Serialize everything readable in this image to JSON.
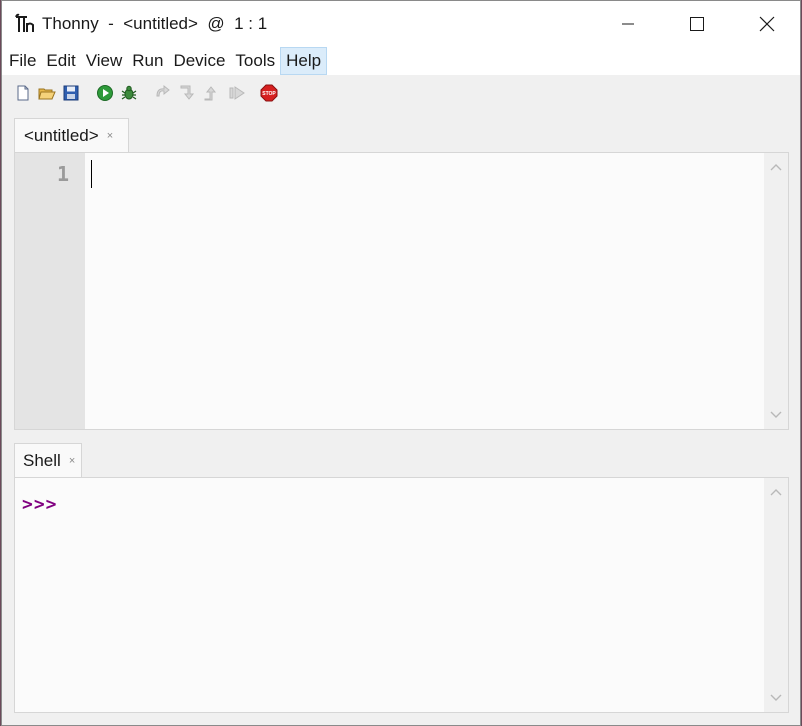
{
  "window": {
    "title": "Thonny  -  <untitled>  @  1 : 1"
  },
  "menu": {
    "items": [
      {
        "label": "File"
      },
      {
        "label": "Edit"
      },
      {
        "label": "View"
      },
      {
        "label": "Run"
      },
      {
        "label": "Device"
      },
      {
        "label": "Tools"
      },
      {
        "label": "Help"
      }
    ]
  },
  "toolbar": {
    "icons": [
      "new-file-icon",
      "open-file-icon",
      "save-icon",
      "run-icon",
      "debug-icon",
      "step-over-icon",
      "step-into-icon",
      "step-out-icon",
      "resume-icon",
      "stop-icon"
    ],
    "stop_label": "STOP"
  },
  "editor": {
    "tab_label": "<untitled>",
    "tab_close": "×",
    "line_number": "1"
  },
  "shell": {
    "tab_label": "Shell",
    "tab_close": "×",
    "prompt": ">>>",
    "prompt_color": "#800080"
  }
}
